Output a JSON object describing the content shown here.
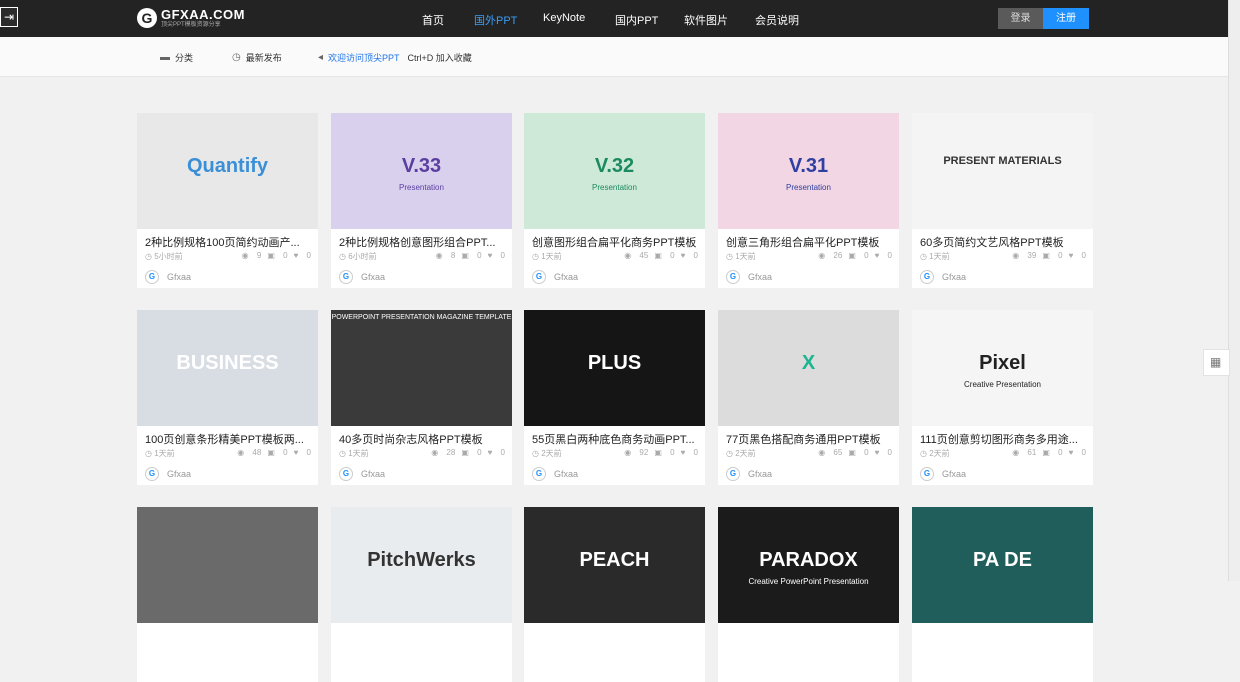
{
  "header": {
    "logo_text": "GFXAA.COM",
    "logo_sub": "顶尖PPT模板资源分享",
    "nav": [
      "首页",
      "国外PPT",
      "KeyNote",
      "国内PPT",
      "软件图片",
      "会员说明"
    ],
    "active_nav": "国外PPT",
    "login": "登录",
    "register": "注册"
  },
  "subbar": {
    "category": "分类",
    "latest": "最新发布",
    "welcome": "欢迎访问顶尖PPT",
    "bookmark": "Ctrl+D 加入收藏"
  },
  "cards": [
    {
      "title": "2种比例规格100页简约动画产...",
      "time": "5小时前",
      "views": "9",
      "comments": "0",
      "likes": "0",
      "author": "Gfxaa",
      "thumb_text": "Quantify",
      "thumb_bg": "#e8e8e8",
      "thumb_fg": "#3a8fd6"
    },
    {
      "title": "2种比例规格创意图形组合PPT...",
      "time": "6小时前",
      "views": "8",
      "comments": "0",
      "likes": "0",
      "author": "Gfxaa",
      "thumb_text": "V.33",
      "thumb_sub": "Presentation",
      "thumb_bg": "#d9d0ee",
      "thumb_fg": "#5a3ea0"
    },
    {
      "title": "创意图形组合扁平化商务PPT模板",
      "time": "1天前",
      "views": "45",
      "comments": "0",
      "likes": "0",
      "author": "Gfxaa",
      "thumb_text": "V.32",
      "thumb_sub": "Presentation",
      "thumb_bg": "#cfe9d9",
      "thumb_fg": "#1b8a60"
    },
    {
      "title": "创意三角形组合扁平化PPT模板",
      "time": "1天前",
      "views": "26",
      "comments": "0",
      "likes": "0",
      "author": "Gfxaa",
      "thumb_text": "V.31",
      "thumb_sub": "Presentation",
      "thumb_bg": "#f2d6e4",
      "thumb_fg": "#3040a0"
    },
    {
      "title": "60多页简约文艺风格PPT模板",
      "time": "1天前",
      "views": "39",
      "comments": "0",
      "likes": "0",
      "author": "Gfxaa",
      "thumb_text": "PRESENT MATERIALS",
      "thumb_bg": "#f4f4f4",
      "thumb_fg": "#333333"
    },
    {
      "title": "100页创意条形精美PPT模板两...",
      "time": "1天前",
      "views": "48",
      "comments": "0",
      "likes": "0",
      "author": "Gfxaa",
      "thumb_text": "BUSINESS",
      "thumb_bg": "#d8dde3",
      "thumb_fg": "#ffffff"
    },
    {
      "title": "40多页时尚杂志风格PPT模板",
      "time": "1天前",
      "views": "28",
      "comments": "0",
      "likes": "0",
      "author": "Gfxaa",
      "thumb_text": "POWERPOINT PRESENTATION MAGAZINE TEMPLATE",
      "thumb_bg": "#3a3a3a",
      "thumb_fg": "#ffffff"
    },
    {
      "title": "55页黑白两种底色商务动画PPT...",
      "time": "2天前",
      "views": "92",
      "comments": "0",
      "likes": "0",
      "author": "Gfxaa",
      "thumb_text": "PLUS",
      "thumb_bg": "#151515",
      "thumb_fg": "#ffffff"
    },
    {
      "title": "77页黑色搭配商务通用PPT模板",
      "time": "2天前",
      "views": "65",
      "comments": "0",
      "likes": "0",
      "author": "Gfxaa",
      "thumb_text": "X",
      "thumb_bg": "#dcdcdc",
      "thumb_fg": "#1cb58f"
    },
    {
      "title": "111页创意剪切图形商务多用途...",
      "time": "2天前",
      "views": "61",
      "comments": "0",
      "likes": "0",
      "author": "Gfxaa",
      "thumb_text": "Pixel",
      "thumb_sub": "Creative Presentation",
      "thumb_bg": "#f5f5f5",
      "thumb_fg": "#222222"
    },
    {
      "title": "",
      "time": "",
      "views": "",
      "comments": "",
      "likes": "",
      "author": "",
      "thumb_text": "",
      "thumb_bg": "#6a6a6a",
      "thumb_fg": "#ffffff"
    },
    {
      "title": "",
      "time": "",
      "views": "",
      "comments": "",
      "likes": "",
      "author": "",
      "thumb_text": "PitchWerks",
      "thumb_bg": "#e9ecef",
      "thumb_fg": "#333333"
    },
    {
      "title": "",
      "time": "",
      "views": "",
      "comments": "",
      "likes": "",
      "author": "",
      "thumb_text": "PEACH",
      "thumb_bg": "#2a2a2a",
      "thumb_fg": "#ffffff"
    },
    {
      "title": "",
      "time": "",
      "views": "",
      "comments": "",
      "likes": "",
      "author": "",
      "thumb_text": "PARADOX",
      "thumb_sub": "Creative PowerPoint Presentation",
      "thumb_bg": "#1b1b1b",
      "thumb_fg": "#ffffff"
    },
    {
      "title": "",
      "time": "",
      "views": "",
      "comments": "",
      "likes": "",
      "author": "",
      "thumb_text": "PA DE",
      "thumb_bg": "#1f5e5a",
      "thumb_fg": "#ffffff"
    }
  ],
  "icons": {
    "views": "eye-icon",
    "comments": "comment-icon",
    "likes": "heart-icon"
  },
  "colors": {
    "accent": "#1e90ff",
    "topbar": "#232323"
  }
}
